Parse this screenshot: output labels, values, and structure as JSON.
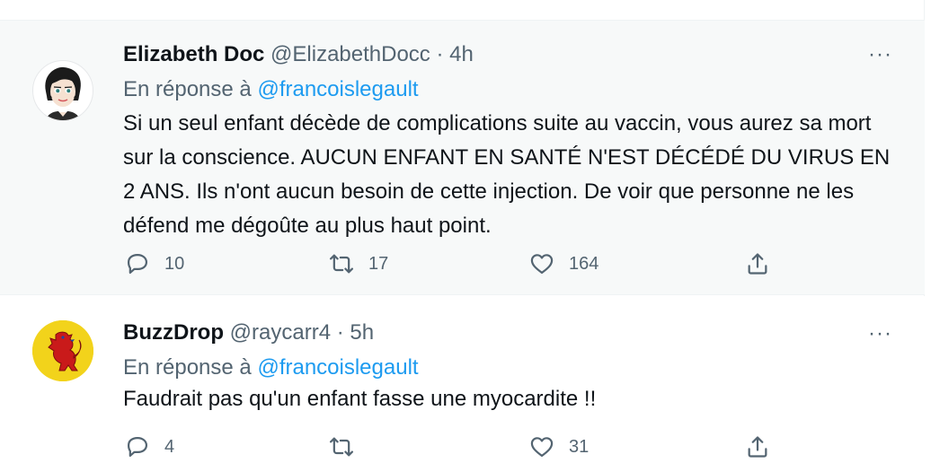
{
  "tweets": [
    {
      "name": "Elizabeth Doc",
      "handle": "@ElizabethDocc",
      "separator": "·",
      "time": "4h",
      "more": "···",
      "reply_prefix": "En réponse à",
      "reply_mention": "@francoislegault",
      "text": "Si un seul enfant décède de complications suite au vaccin, vous aurez sa mort sur la conscience. AUCUN ENFANT EN SANTÉ N'EST DÉCÉDÉ DU VIRUS EN 2 ANS. Ils n'ont aucun besoin de cette injection. De voir que personne ne les défend me dégoûte au plus haut point.",
      "replies": "10",
      "retweets": "17",
      "likes": "164",
      "avatar_icon": "cartoon-woman-avatar"
    },
    {
      "name": "BuzzDrop",
      "handle": "@raycarr4",
      "separator": "·",
      "time": "5h",
      "more": "···",
      "reply_prefix": "En réponse à",
      "reply_mention": "@francoislegault",
      "text": "Faudrait pas qu'un enfant fasse une myocardite !!",
      "replies": "4",
      "retweets": "",
      "likes": "31",
      "avatar_icon": "red-lion-rampant-avatar"
    }
  ],
  "colors": {
    "accent": "#1d9bf0",
    "secondary_text": "#536471",
    "highlight_bg": "#f7f9f9"
  }
}
